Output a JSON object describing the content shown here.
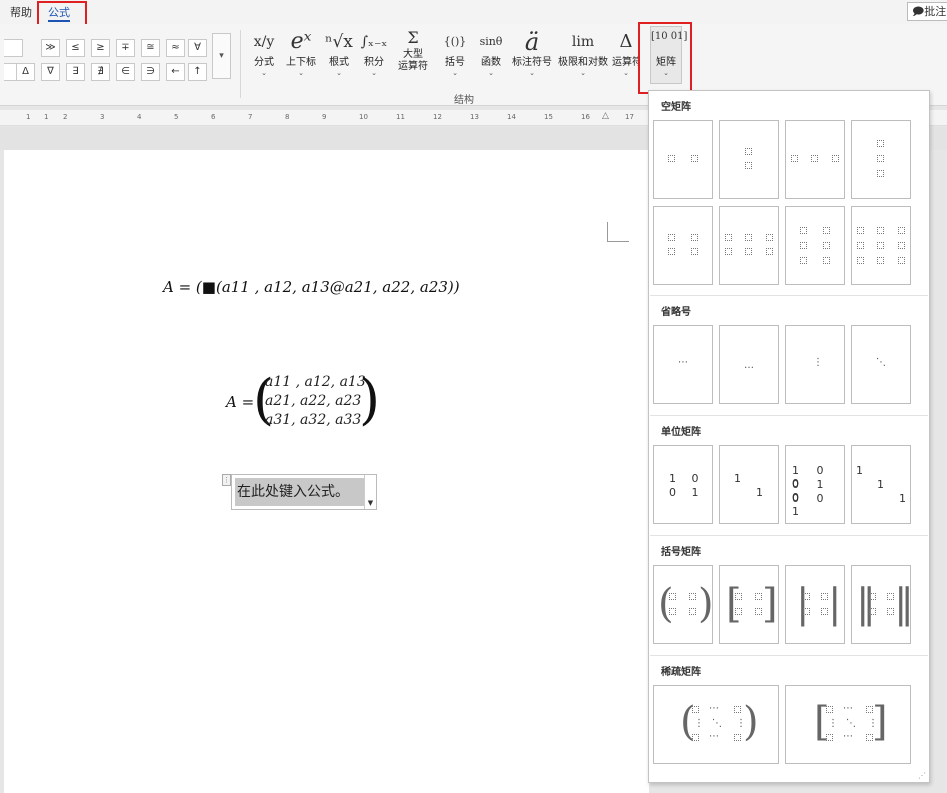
{
  "tabs": {
    "help": "帮助",
    "formula": "公式"
  },
  "comment_button": "批注",
  "symbols": {
    "row1": [
      "≫",
      "≤",
      "≥",
      "∓",
      "≅",
      "≈",
      "≡",
      "∀"
    ],
    "row2": [
      "Δ",
      "∇",
      "∃",
      "∄",
      "∈",
      "∋",
      "←",
      "↑"
    ],
    "more": "▾"
  },
  "structure_buttons": [
    {
      "icon": "x/y",
      "label": "分式"
    },
    {
      "icon": "eˣ",
      "label": "上下标"
    },
    {
      "icon": "ⁿ√x",
      "label": "根式"
    },
    {
      "icon": "∫ₓ₋ₓ",
      "label": "积分"
    },
    {
      "icon": "Σ",
      "label": "大型 运算符"
    },
    {
      "icon": "{()}",
      "label": "括号"
    },
    {
      "icon": "sinθ",
      "label": "函数"
    },
    {
      "icon": "ä",
      "label": "标注符号"
    },
    {
      "icon": "lim",
      "label": "极限和对数"
    },
    {
      "icon": "Δ",
      "label": "运算符"
    },
    {
      "icon": "[10 01]",
      "label": "矩阵"
    }
  ],
  "group_label": "结构",
  "ruler_ticks": [
    "1",
    "1",
    "2",
    "3",
    "4",
    "5",
    "6",
    "7",
    "8",
    "9",
    "10",
    "11",
    "12",
    "13",
    "14",
    "15",
    "16",
    "17"
  ],
  "document": {
    "formula1": "A = (■(a11 , a12, a13@a21, a22, a23))",
    "formula2_lhs": "A =",
    "matrix_rows": [
      "a11 , a12, a13",
      "a21, a22, a23",
      "a31, a32, a33"
    ],
    "input_placeholder": "在此处键入公式。"
  },
  "matrix_panel": {
    "sections": {
      "empty": "空矩阵",
      "ellipsis": "省略号",
      "identity": "单位矩阵",
      "bracket": "括号矩阵",
      "sparse": "稀疏矩阵"
    },
    "ellipsis_glyphs": [
      "⋯",
      "…",
      "⋮",
      "⋱"
    ],
    "identity": {
      "i2_row1": "1 0",
      "i2_row2": "0 1",
      "i2s_a": "1",
      "i2s_b": "1",
      "i3_row1": "1 0 0",
      "i3_row2": "0 1 0",
      "i3_row3": "0 0 1",
      "i3s_a": "1",
      "i3s_b": "1",
      "i3s_c": "1"
    }
  },
  "colors": {
    "highlight": "#e02020",
    "accent": "#1e55b3"
  }
}
